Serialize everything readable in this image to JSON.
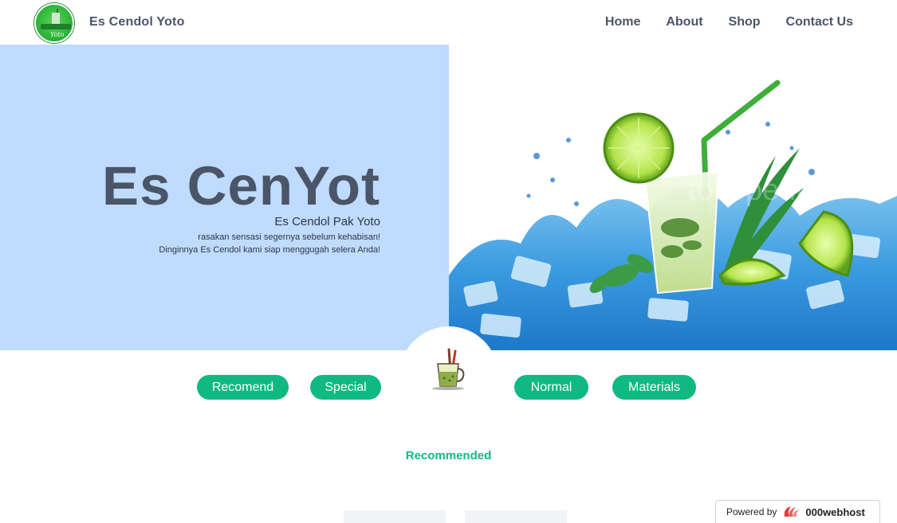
{
  "navbar": {
    "brand": "Es Cendol Yoto",
    "logo_text": "Yoto",
    "links": [
      "Home",
      "About",
      "Shop",
      "Contact Us"
    ]
  },
  "hero": {
    "title": "Es CenYot",
    "subtitle": "Es Cendol Pak Yoto",
    "line1": "rasakan sensasi segernya sebelum kehabisan!",
    "line2": "Dinginnya Es Cendol kami siap menggugah selera Anda!",
    "image_watermark": "tokopedia"
  },
  "categories": [
    "Recomend",
    "Special",
    "Normal",
    "Materials"
  ],
  "section": {
    "title": "Recommended"
  },
  "footer_badge": {
    "label": "Powered by",
    "brand": "000webhost"
  },
  "colors": {
    "accent": "#10b981",
    "hero_bg": "#bfdbfe",
    "text_dark": "#4a5568"
  },
  "icons": [
    "logo-icon",
    "drink-cup-icon",
    "webhost-icon"
  ]
}
